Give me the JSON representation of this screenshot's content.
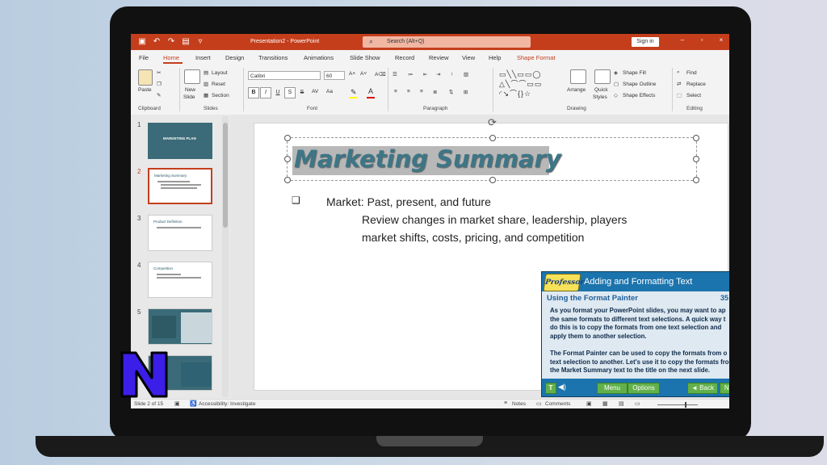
{
  "colors": {
    "accent": "#c43e1c",
    "title_text": "#3d7686",
    "tutorial_blue": "#1b74ad",
    "tutorial_btn": "#62b04a",
    "n_logo": "#3b1ee8"
  },
  "titlebar": {
    "doc_title": "Presentation2  -  PowerPoint",
    "search": "Search (Alt+Q)",
    "signin": "Sign in"
  },
  "menu": {
    "tabs": [
      "File",
      "Home",
      "Insert",
      "Design",
      "Transitions",
      "Animations",
      "Slide Show",
      "Record",
      "Review",
      "View",
      "Help",
      "Shape Format"
    ],
    "active": "Home"
  },
  "ribbon": {
    "clipboard": {
      "paste": "Paste",
      "label": "Clipboard"
    },
    "slides": {
      "new_slide": "New",
      "new_slide2": "Slide",
      "layout": "Layout",
      "reset": "Reset",
      "section": "Section",
      "label": "Slides"
    },
    "font": {
      "name": "Calibri",
      "size": "60",
      "bold": "B",
      "italic": "I",
      "underline": "U",
      "strike": "S",
      "shadow": "S",
      "label": "Font"
    },
    "paragraph": {
      "label": "Paragraph"
    },
    "drawing": {
      "arrange": "Arrange",
      "quick_styles": "Quick",
      "quick_styles2": "Styles",
      "shape_fill": "Shape Fill",
      "shape_outline": "Shape Outline",
      "shape_effects": "Shape Effects",
      "label": "Drawing"
    },
    "editing": {
      "find": "Find",
      "replace": "Replace",
      "select": "Select",
      "label": "Editing"
    }
  },
  "thumbnails": [
    {
      "num": "1",
      "title": "MARKETING PLAN"
    },
    {
      "num": "2",
      "title": "Marketing Summary"
    },
    {
      "num": "3",
      "title": "Product Definition"
    },
    {
      "num": "4",
      "title": "Competition"
    },
    {
      "num": "5",
      "title": ""
    }
  ],
  "slide": {
    "title": "Marketing Summary",
    "bullet1": "Market: Past, present, and future",
    "sub1": "Review changes in market share, leadership, players",
    "sub2": "market shifts, costs, pricing, and competition"
  },
  "tutorial": {
    "logo": "Professor",
    "heading": "Adding and Formatting Text",
    "subheading": "Using the Format Painter",
    "page": "35",
    "para1": [
      "As you format your PowerPoint slides, you may want to ap",
      "the same formats to different text selections. A quick way t",
      "do this is to copy the formats from one text selection and",
      "apply them to another selection."
    ],
    "para2": [
      "The Format Painter can be used to copy the formats from o",
      "text selection to another. Let's use it to copy the formats fro",
      "the Market Summary text to the title on the next slide."
    ],
    "t_btn": "T",
    "menu_btn": "Menu",
    "options_btn": "Options",
    "back_btn": "◄ Back",
    "next_btn": "Ne"
  },
  "statusbar": {
    "slide_info": "Slide 2 of 15",
    "accessibility": "Accessibility: Investigate",
    "notes": "Notes",
    "comments": "Comments"
  }
}
